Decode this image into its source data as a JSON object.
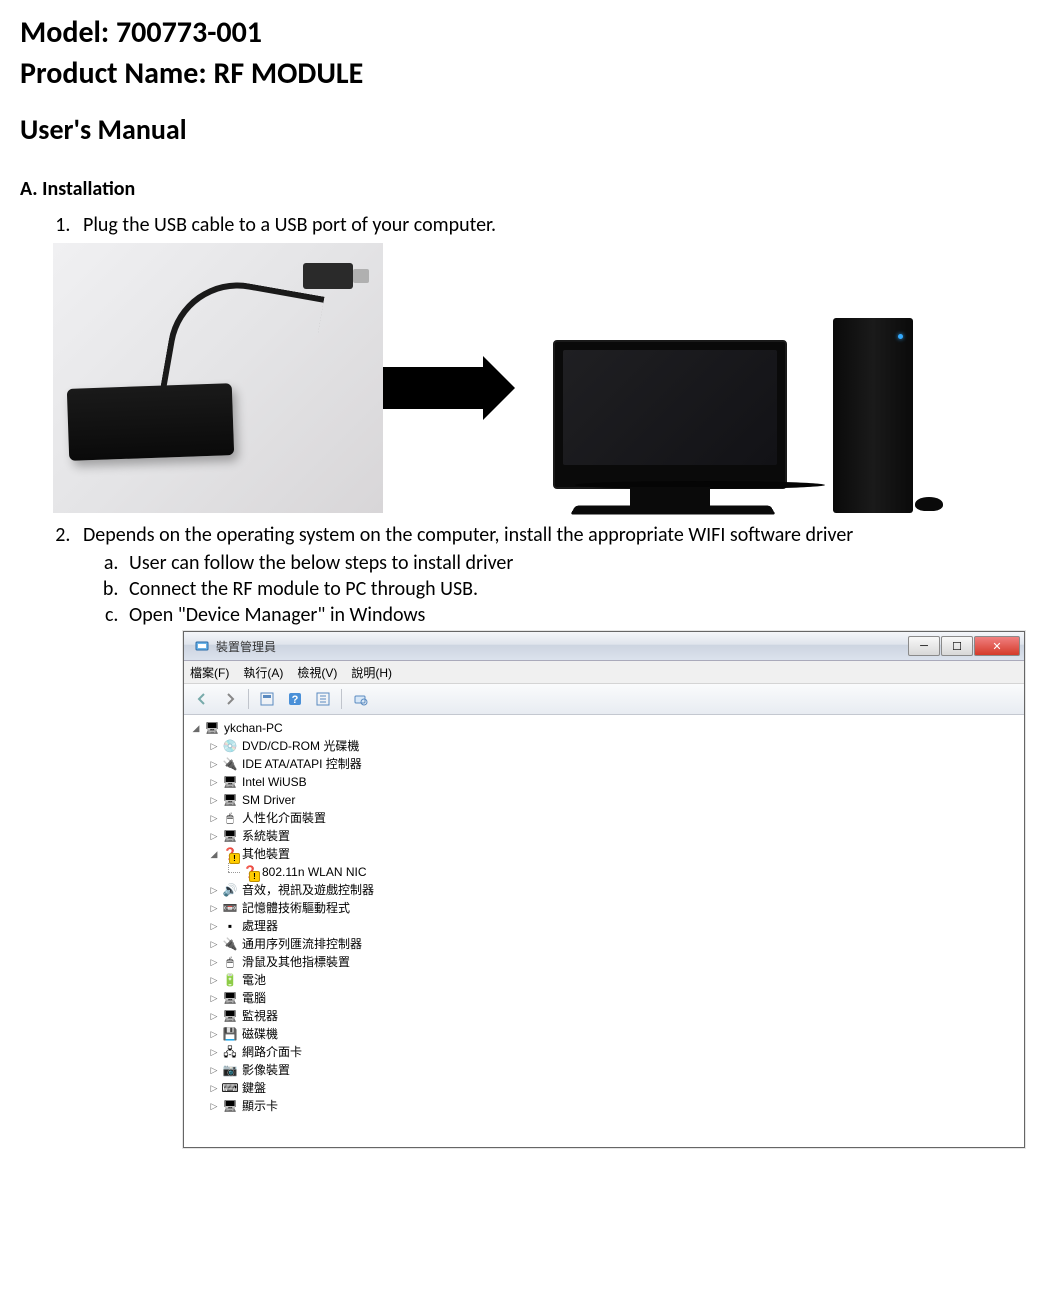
{
  "header": {
    "model_line": "Model: 700773-001",
    "product_line": "Product Name: RF MODULE",
    "manual_title": "User's Manual"
  },
  "sectionA": {
    "title": "A. Installation",
    "step1": "Plug the USB cable to a USB port of your computer.",
    "step2": "Depends on the operating system on the computer, install the appropriate WIFI software driver",
    "step2a": "User can follow the below steps to install driver",
    "step2b": "Connect the RF module to PC through USB.",
    "step2c": "Open \"Device Manager\" in Windows"
  },
  "deviceManager": {
    "title": "裝置管理員",
    "menu": {
      "file": "檔案(F)",
      "action": "執行(A)",
      "view": "檢視(V)",
      "help": "說明(H)"
    },
    "root": "ykchan-PC",
    "nodes": [
      {
        "label": "DVD/CD-ROM 光碟機",
        "icon": "💿"
      },
      {
        "label": "IDE ATA/ATAPI 控制器",
        "icon": "🔌"
      },
      {
        "label": "Intel WiUSB",
        "icon": "🖥"
      },
      {
        "label": "SM Driver",
        "icon": "🖥"
      },
      {
        "label": "人性化介面裝置",
        "icon": "🖱"
      },
      {
        "label": "系統裝置",
        "icon": "🖥"
      }
    ],
    "otherDevices": {
      "label": "其他裝置",
      "child": "802.11n WLAN NIC"
    },
    "nodes2": [
      {
        "label": "音效，視訊及遊戲控制器",
        "icon": "🔊"
      },
      {
        "label": "記憶體技術驅動程式",
        "icon": "📼"
      },
      {
        "label": "處理器",
        "icon": "▪"
      },
      {
        "label": "通用序列匯流排控制器",
        "icon": "🔌"
      },
      {
        "label": "滑鼠及其他指標裝置",
        "icon": "🖱"
      },
      {
        "label": "電池",
        "icon": "🔋"
      },
      {
        "label": "電腦",
        "icon": "🖥"
      },
      {
        "label": "監視器",
        "icon": "🖥"
      },
      {
        "label": "磁碟機",
        "icon": "💾"
      },
      {
        "label": "網路介面卡",
        "icon": "🖧"
      },
      {
        "label": "影像裝置",
        "icon": "📷"
      },
      {
        "label": "鍵盤",
        "icon": "⌨"
      },
      {
        "label": "顯示卡",
        "icon": "🖥"
      }
    ]
  }
}
